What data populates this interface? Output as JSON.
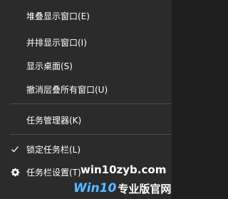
{
  "menu": {
    "items": [
      {
        "label": "堆叠显示窗口(E)"
      },
      {
        "label": "并排显示窗口(I)"
      },
      {
        "label": "显示桌面(S)"
      },
      {
        "label": "撤消层叠所有窗口(U)"
      },
      {
        "label": "任务管理器(K)"
      },
      {
        "label": "锁定任务栏(L)",
        "checked": true,
        "icon": "checkmark-icon"
      },
      {
        "label": "任务栏设置(T)",
        "icon": "gear-icon"
      }
    ]
  },
  "watermark": {
    "url": "win10zyb.com",
    "logo_win": "Win10",
    "logo_site": "专业版官网"
  },
  "colors": {
    "background": "#2b2b2b",
    "text": "#ffffff",
    "separator": "#4a4a4a",
    "watermark_blue": "#5fb8ff"
  }
}
